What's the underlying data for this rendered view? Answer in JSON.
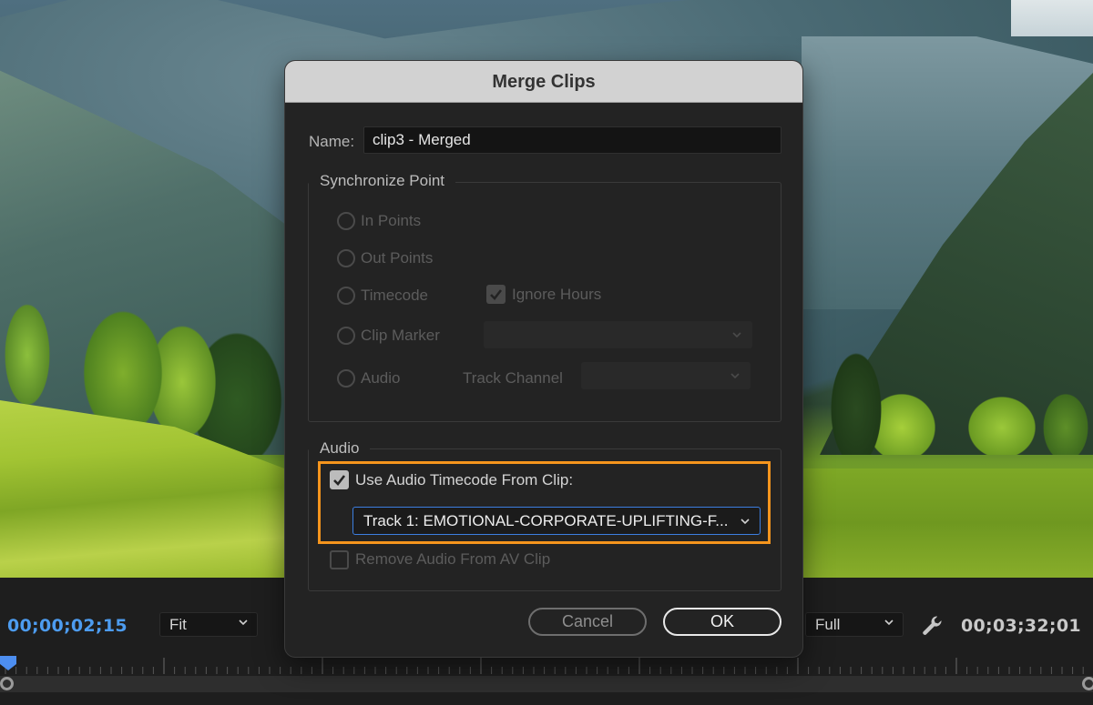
{
  "monitor": {
    "current_timecode": "00;00;02;15",
    "duration_timecode": "00;03;32;01",
    "zoom_select": {
      "value": "Fit"
    },
    "resolution_select": {
      "value": "Full"
    },
    "settings_icon": "wrench-icon",
    "playhead_position": 0.0
  },
  "dialog": {
    "title": "Merge Clips",
    "name_label": "Name:",
    "name_value": "clip3 - Merged",
    "sync_point": {
      "title": "Synchronize Point",
      "options": [
        {
          "label": "In Points",
          "selected": false,
          "enabled": false
        },
        {
          "label": "Out Points",
          "selected": false,
          "enabled": false
        },
        {
          "label": "Timecode",
          "selected": false,
          "enabled": false
        },
        {
          "label": "Clip Marker",
          "selected": false,
          "enabled": false
        },
        {
          "label": "Audio",
          "selected": false,
          "enabled": false
        }
      ],
      "ignore_hours": {
        "label": "Ignore Hours",
        "checked": true,
        "enabled": false
      },
      "clip_marker_select": {
        "value": "",
        "enabled": false
      },
      "track_channel_label": "Track Channel",
      "track_channel_select": {
        "value": "",
        "enabled": false
      }
    },
    "audio": {
      "title": "Audio",
      "use_audio_timecode": {
        "label": "Use Audio Timecode From Clip:",
        "checked": true,
        "enabled": true
      },
      "track_select": {
        "value": "Track 1: EMOTIONAL-CORPORATE-UPLIFTING-F..."
      },
      "remove_audio": {
        "label": "Remove Audio From AV Clip",
        "checked": false,
        "enabled": false
      }
    },
    "highlight_color": "#f5951d",
    "buttons": {
      "cancel": "Cancel",
      "ok": "OK"
    }
  }
}
